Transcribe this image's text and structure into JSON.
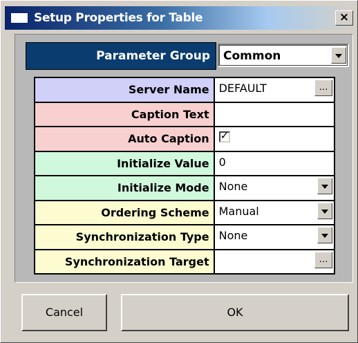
{
  "window": {
    "title": "Setup Properties for Table",
    "close_label": "×"
  },
  "parameter_group": {
    "label": "Parameter Group",
    "selected": "Common"
  },
  "properties": [
    {
      "label": "Server Name",
      "value": "DEFAULT",
      "editor": "ellipsis",
      "color": "#d0d0f8"
    },
    {
      "label": "Caption Text",
      "value": "",
      "editor": "text",
      "color": "#f8d0d0"
    },
    {
      "label": "Auto Caption",
      "checked": true,
      "editor": "checkbox",
      "color": "#f8d0d0"
    },
    {
      "label": "Initialize Value",
      "value": "0",
      "editor": "text",
      "color": "#d0f8dc"
    },
    {
      "label": "Initialize Mode",
      "value": "None",
      "editor": "dropdown",
      "color": "#d0f8dc"
    },
    {
      "label": "Ordering Scheme",
      "value": "Manual",
      "editor": "dropdown",
      "color": "#fcfcd0"
    },
    {
      "label": "Synchronization Type",
      "value": "None",
      "editor": "dropdown",
      "color": "#fcfcd0"
    },
    {
      "label": "Synchronization Target",
      "value": "",
      "editor": "ellipsis",
      "color": "#fcfcd0"
    }
  ],
  "buttons": {
    "cancel": "Cancel",
    "ok": "OK"
  },
  "colors": {
    "header_bg": "#0b3c6f",
    "panel_bg": "#b8b8b8",
    "dialog_bg": "#d4d0c8"
  },
  "icons": {
    "ellipsis": "…",
    "check": "✓"
  }
}
